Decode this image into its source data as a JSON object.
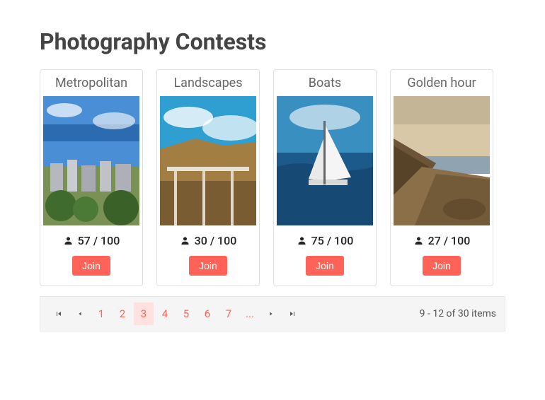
{
  "title": "Photography Contests",
  "contests": [
    {
      "title": "Metropolitan",
      "count": "57 / 100",
      "button": "Join"
    },
    {
      "title": "Landscapes",
      "count": "30 / 100",
      "button": "Join"
    },
    {
      "title": "Boats",
      "count": "75 / 100",
      "button": "Join"
    },
    {
      "title": "Golden hour",
      "count": "27 / 100",
      "button": "Join"
    }
  ],
  "pager": {
    "pages": [
      "1",
      "2",
      "3",
      "4",
      "5",
      "6",
      "7",
      "..."
    ],
    "active_index": 2,
    "info": "9 - 12 of 30 items"
  }
}
